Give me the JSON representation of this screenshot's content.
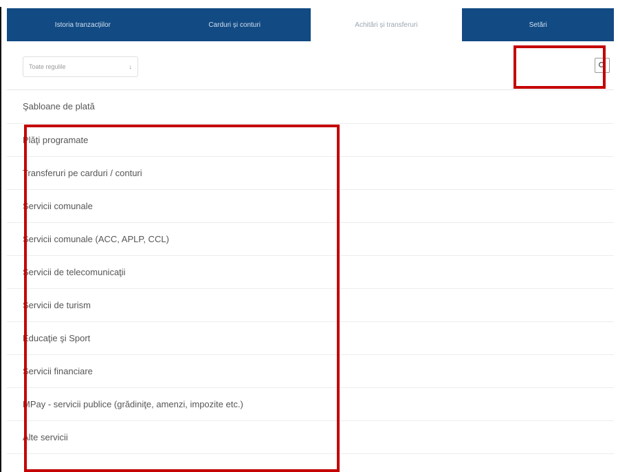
{
  "tabs": [
    {
      "label": "Istoria tranzacțiilor"
    },
    {
      "label": "Carduri și conturi"
    },
    {
      "label": "Achitări și transferuri"
    },
    {
      "label": "Setări"
    }
  ],
  "filter": {
    "selected": "Toate regulile",
    "icon": "chevron-down-icon"
  },
  "search": {
    "icon": "search-icon"
  },
  "menu": {
    "items": [
      {
        "label": "Şabloane de plată"
      },
      {
        "label": "Plăţi programate"
      },
      {
        "label": "Transferuri pe carduri / conturi"
      },
      {
        "label": "Servicii comunale"
      },
      {
        "label": "Servicii comunale (ACC, APLP, CCL)"
      },
      {
        "label": "Servicii de telecomunicaţii"
      },
      {
        "label": "Servicii de turism"
      },
      {
        "label": "Educaţie şi Sport"
      },
      {
        "label": "Servicii financiare"
      },
      {
        "label": "MPay - servicii publice (grădiniţe, amenzi, impozite etc.)"
      },
      {
        "label": "Alte servicii"
      }
    ]
  },
  "colors": {
    "tabbar": "#124a83",
    "highlight": "#c40000"
  }
}
